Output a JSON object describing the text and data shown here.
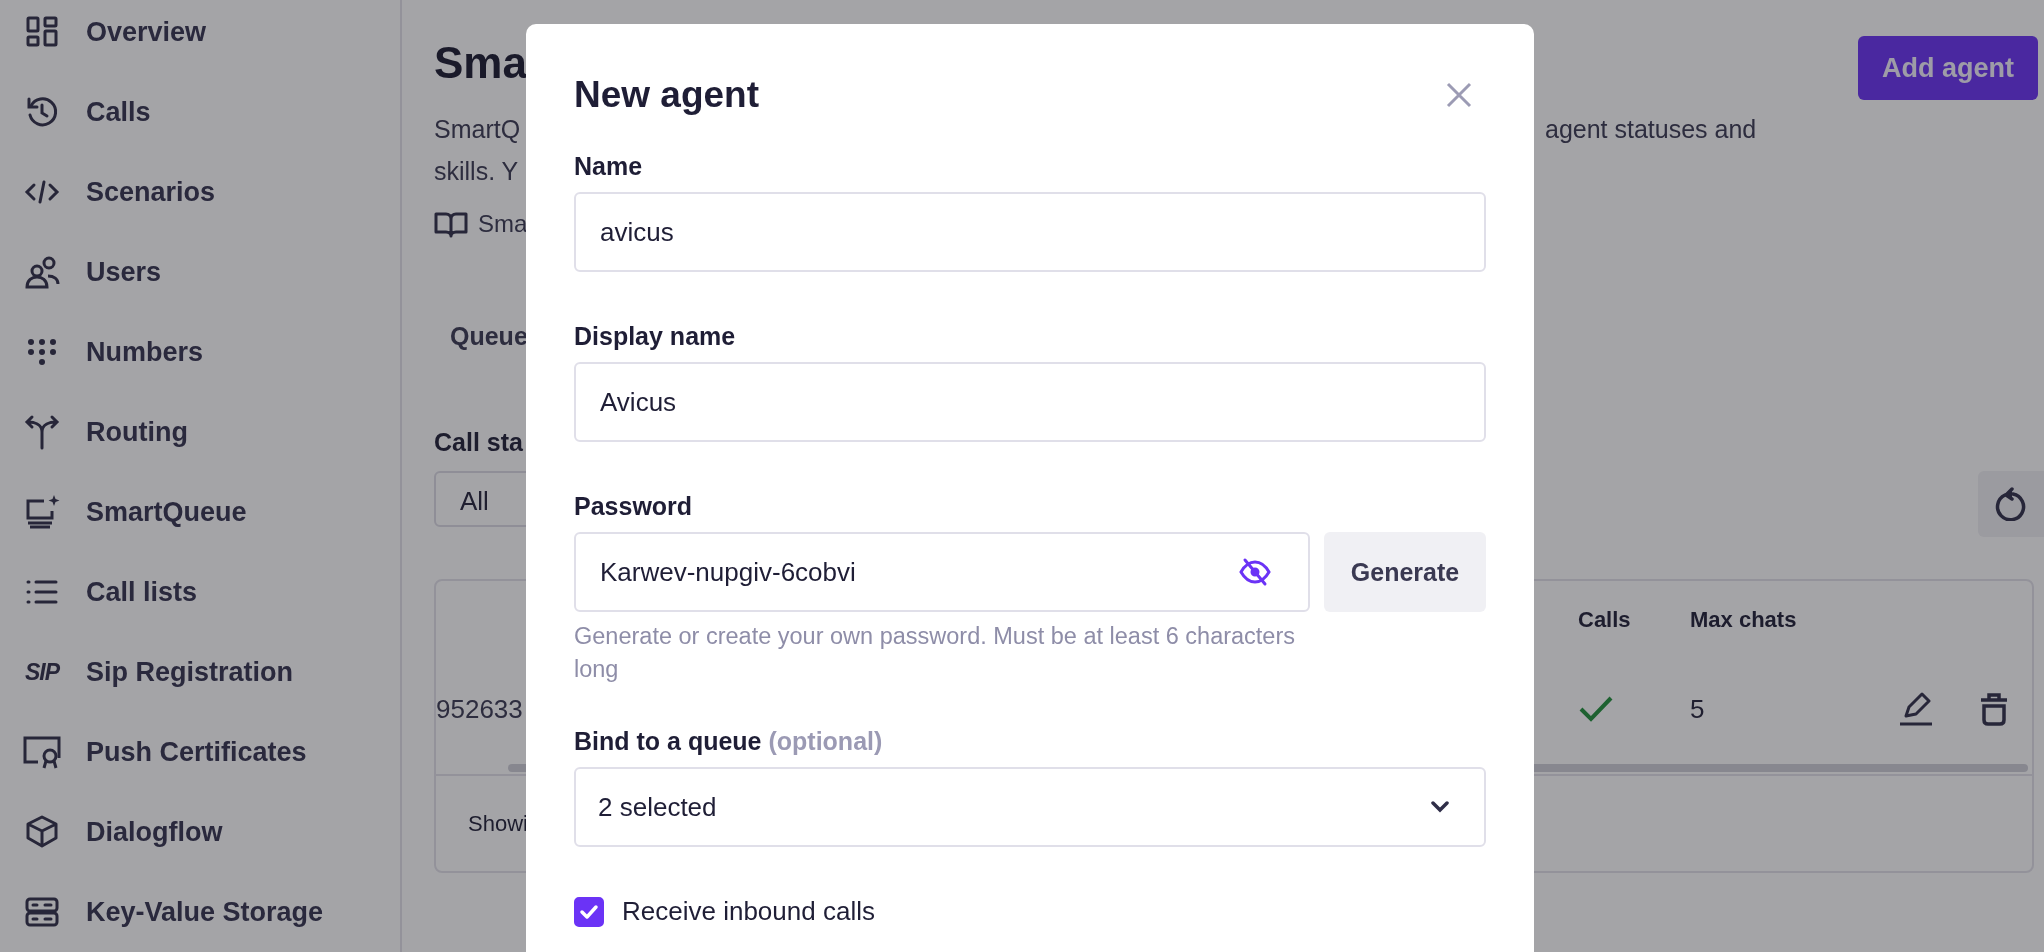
{
  "sidebar": {
    "items": [
      {
        "label": "Overview"
      },
      {
        "label": "Calls"
      },
      {
        "label": "Scenarios"
      },
      {
        "label": "Users"
      },
      {
        "label": "Numbers"
      },
      {
        "label": "Routing"
      },
      {
        "label": "SmartQueue"
      },
      {
        "label": "Call lists"
      },
      {
        "label": "Sip Registration",
        "glyph": "SIP"
      },
      {
        "label": "Push Certificates"
      },
      {
        "label": "Dialogflow"
      },
      {
        "label": "Key-Value Storage"
      }
    ]
  },
  "page": {
    "title": "Sma",
    "add_button": "Add agent",
    "description_left": [
      "SmartQ",
      "skills. Y"
    ],
    "description_right": "agent statuses and",
    "doc_link": "Sma",
    "tab": "Queue",
    "filter_label": "Call sta",
    "filter_value": "All",
    "table": {
      "columns": [
        "Calls",
        "Max chats"
      ],
      "row": {
        "id": "952633",
        "calls": true,
        "max_chats": "5"
      },
      "footer": "Showi"
    }
  },
  "modal": {
    "title": "New agent",
    "fields": [
      {
        "label": "Name",
        "value": "avicus"
      },
      {
        "label": "Display name",
        "value": "Avicus"
      }
    ],
    "password": {
      "label": "Password",
      "value": "Karwev-nupgiv-6cobvi",
      "visible": true,
      "generate": "Generate",
      "help": "Generate or create your own password. Must be at least 6 characters long"
    },
    "queue": {
      "label": "Bind to a queue",
      "optional": "(optional)",
      "value": "2 selected"
    },
    "inbound": {
      "label": "Receive inbound calls",
      "checked": true
    }
  }
}
